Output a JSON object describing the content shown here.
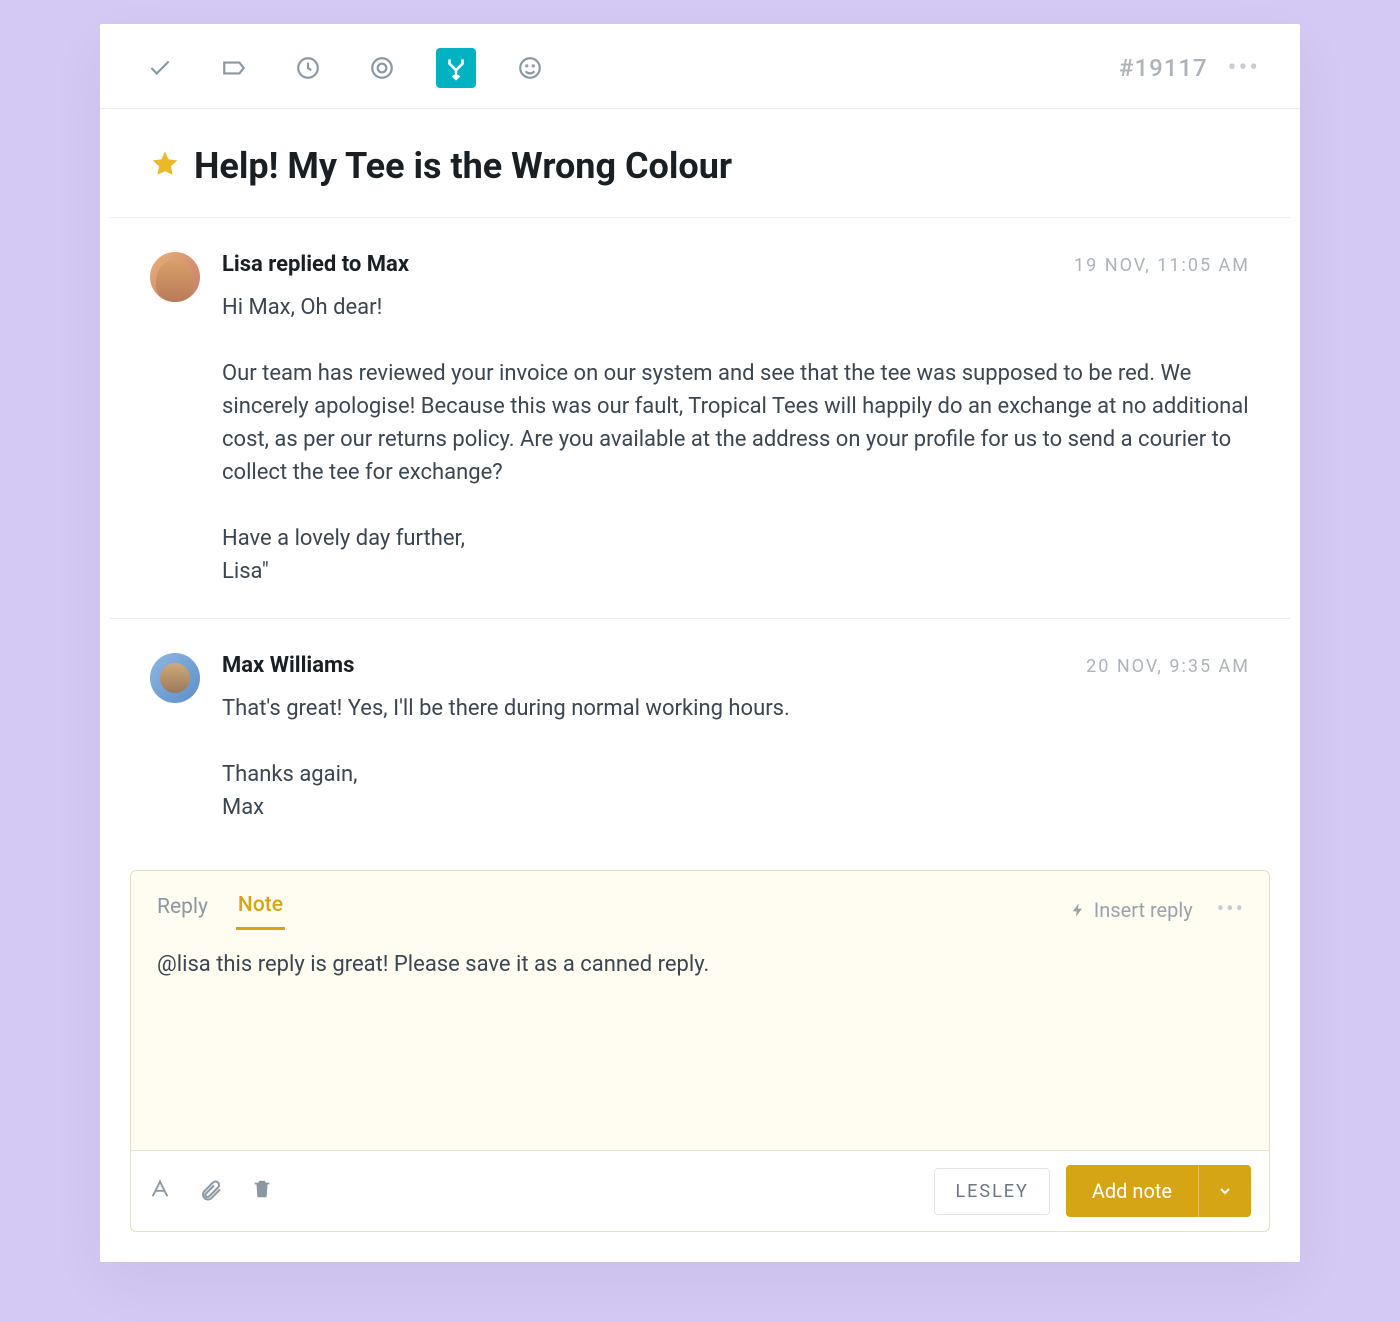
{
  "toolbar": {
    "ticket_id": "#19117"
  },
  "subject": "Help! My Tee is the Wrong Colour",
  "messages": [
    {
      "author": "Lisa replied to Max",
      "time": "19 NOV, 11:05 AM",
      "body": "Hi Max, Oh dear!\n\nOur team has reviewed your invoice on our system and see that the tee was supposed to be red. We sincerely apologise! Because this was our fault, Tropical Tees will happily do an exchange at no additional cost, as per our returns policy. Are you available at the address on your profile for us to send a courier to collect the tee for exchange?\n\nHave a lovely day further,\nLisa\""
    },
    {
      "author": "Max Williams",
      "time": "20 NOV, 9:35 AM",
      "body": "That's great! Yes, I'll be there during normal working hours.\n\nThanks again,\nMax"
    }
  ],
  "composer": {
    "tabs": {
      "reply": "Reply",
      "note": "Note"
    },
    "insert_reply": "Insert reply",
    "body": "@lisa this reply is great! Please save it as a canned reply.",
    "user_chip": "LESLEY",
    "add_button": "Add note"
  }
}
